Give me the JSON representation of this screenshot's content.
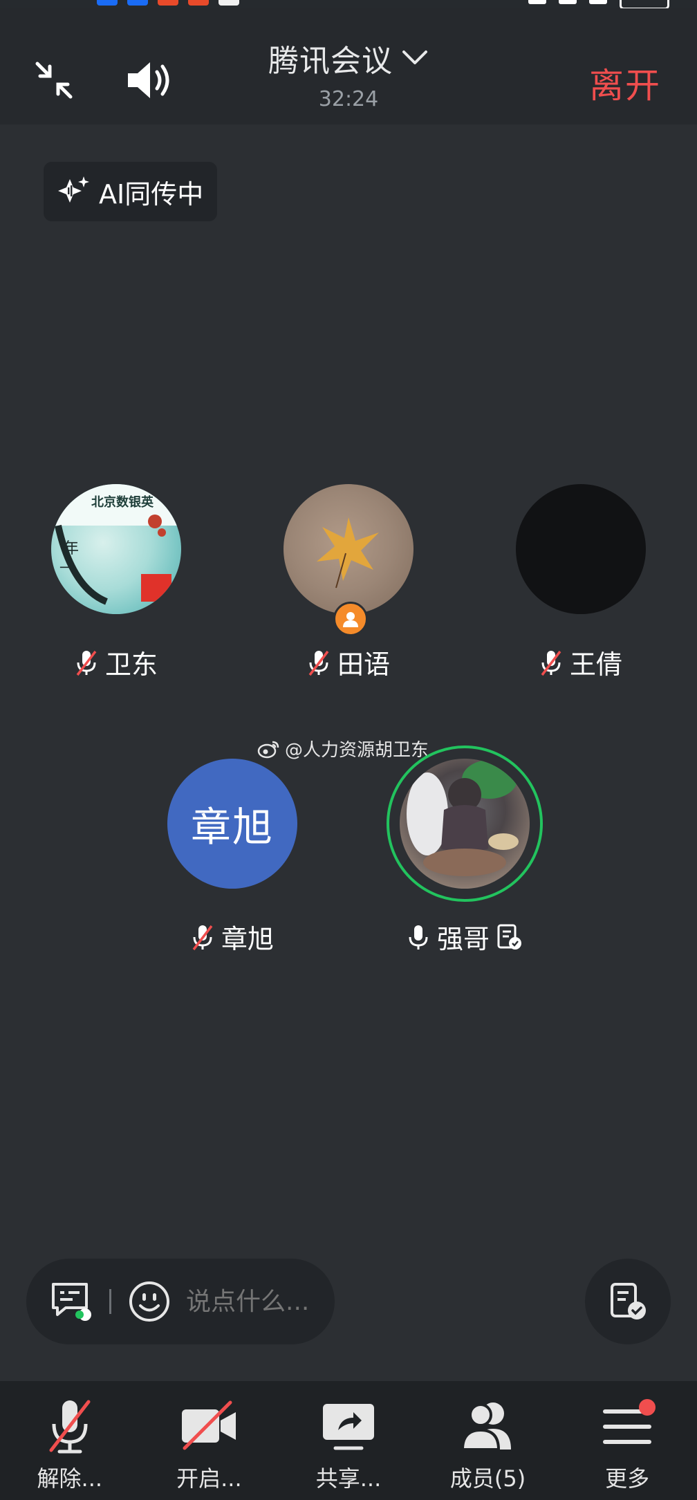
{
  "header": {
    "title": "腾讯会议",
    "timer": "32:24",
    "leave_label": "离开"
  },
  "ai_badge": {
    "label": "AI同传中"
  },
  "participants": [
    {
      "name": "卫东",
      "mic": "muted"
    },
    {
      "name": "田语",
      "mic": "muted",
      "role": "host"
    },
    {
      "name": "王倩",
      "mic": "muted"
    },
    {
      "name": "章旭",
      "mic": "muted",
      "avatar_text": "章旭"
    },
    {
      "name": "强哥",
      "mic": "on",
      "speaking": true
    }
  ],
  "watermark": {
    "text": "@人力资源胡卫东"
  },
  "chat": {
    "placeholder": "说点什么..."
  },
  "toolbar": {
    "unmute_label": "解除...",
    "video_label": "开启...",
    "share_label": "共享...",
    "members_label": "成员(5)",
    "more_label": "更多"
  },
  "colors": {
    "background": "#2c2f33",
    "leave": "#f04e4e",
    "speaking_ring": "#22c35e",
    "avatar_blue": "#4169c1",
    "host_badge": "#f58b2a"
  }
}
